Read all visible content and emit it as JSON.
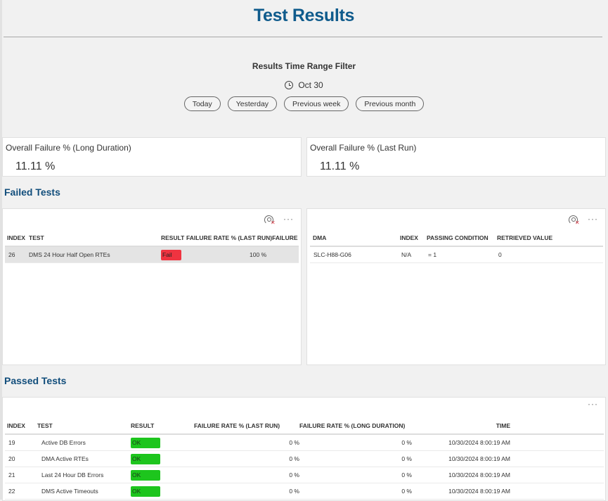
{
  "page": {
    "title": "Test Results"
  },
  "filter": {
    "title": "Results Time Range Filter",
    "date_icon": "clock-icon",
    "date": "Oct 30",
    "buttons": [
      {
        "label": "Today"
      },
      {
        "label": "Yesterday"
      },
      {
        "label": "Previous week"
      },
      {
        "label": "Previous month"
      }
    ]
  },
  "kpis": [
    {
      "label": "Overall Failure % (Long Duration)",
      "value": "11.11 %"
    },
    {
      "label": "Overall Failure % (Last Run)",
      "value": "11.11 %"
    }
  ],
  "failed_tests": {
    "section_title": "Failed Tests",
    "icons": {
      "hide": "eye-hidden-icon",
      "more": "more-options-icon"
    },
    "columns": [
      "INDEX",
      "TEST",
      "RESULT",
      "FAILURE RATE % (LAST RUN)",
      "FAILURE RAT"
    ],
    "rows": [
      {
        "index": "26",
        "test": "DMS 24 Hour Half Open RTEs",
        "result": "Fail",
        "failure_rate_last_run": "100 %"
      }
    ]
  },
  "failed_details": {
    "icons": {
      "hide": "eye-hidden-icon",
      "more": "more-options-icon"
    },
    "columns": [
      "DMA",
      "INDEX",
      "PASSING CONDITION",
      "RETRIEVED VALUE"
    ],
    "rows": [
      {
        "dma": "SLC-H88-G06",
        "index": "N/A",
        "passing_condition": "= 1",
        "retrieved_value": "0"
      }
    ]
  },
  "passed_tests": {
    "section_title": "Passed Tests",
    "icons": {
      "more": "more-options-icon"
    },
    "columns": [
      "INDEX",
      "TEST",
      "RESULT",
      "FAILURE RATE % (LAST RUN)",
      "FAILURE RATE % (LONG DURATION)",
      "TIME"
    ],
    "rows": [
      {
        "index": "19",
        "test": "Active DB Errors",
        "result": "OK",
        "last_run": "0 %",
        "long_duration": "0 %",
        "time": "10/30/2024 8:00:19 AM"
      },
      {
        "index": "20",
        "test": "DMA Active RTEs",
        "result": "OK",
        "last_run": "0 %",
        "long_duration": "0 %",
        "time": "10/30/2024 8:00:19 AM"
      },
      {
        "index": "21",
        "test": "Last 24 Hour DB Errors",
        "result": "OK",
        "last_run": "0 %",
        "long_duration": "0 %",
        "time": "10/30/2024 8:00:19 AM"
      },
      {
        "index": "22",
        "test": "DMS Active Timeouts",
        "result": "OK",
        "last_run": "0 %",
        "long_duration": "0 %",
        "time": "10/30/2024 8:00:19 AM"
      }
    ]
  },
  "colors": {
    "title": "#0f5b8c",
    "fail": "#ef3340",
    "ok": "#1dc51d"
  }
}
